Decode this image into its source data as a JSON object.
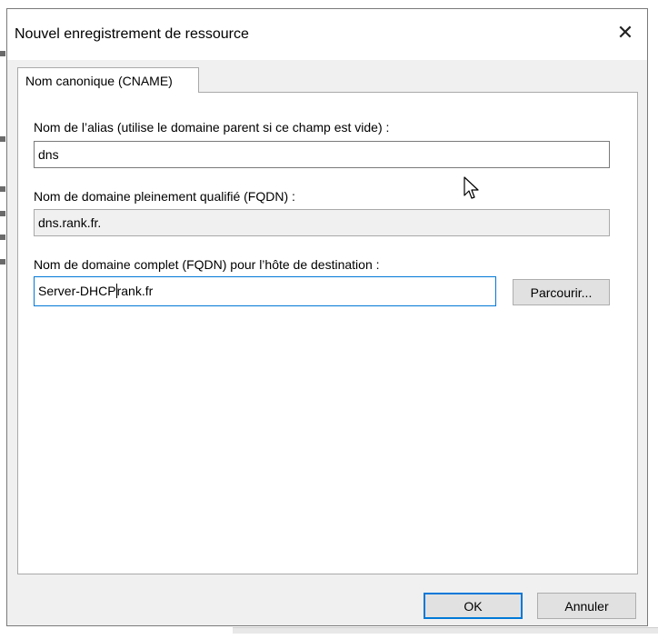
{
  "dialog": {
    "title": "Nouvel enregistrement de ressource",
    "close_glyph": "✕"
  },
  "tab": {
    "label": "Nom canonique (CNAME)"
  },
  "form": {
    "alias_label": "Nom de l’alias (utilise le domaine parent si ce champ est vide) :",
    "alias_value": "dns",
    "fqdn_label": "Nom de domaine pleinement qualifié (FQDN) :",
    "fqdn_value": "dns.rank.fr.",
    "target_label": "Nom de domaine complet (FQDN) pour l’hôte de destination :",
    "target_value_before_caret": "Server-DHCP",
    "target_value_after_caret": "rank.fr",
    "browse_label": "Parcourir..."
  },
  "buttons": {
    "ok_label": "OK",
    "cancel_label": "Annuler"
  },
  "colors": {
    "focus_accent": "#0078d7",
    "dialog_bg": "#f0f0f0"
  }
}
